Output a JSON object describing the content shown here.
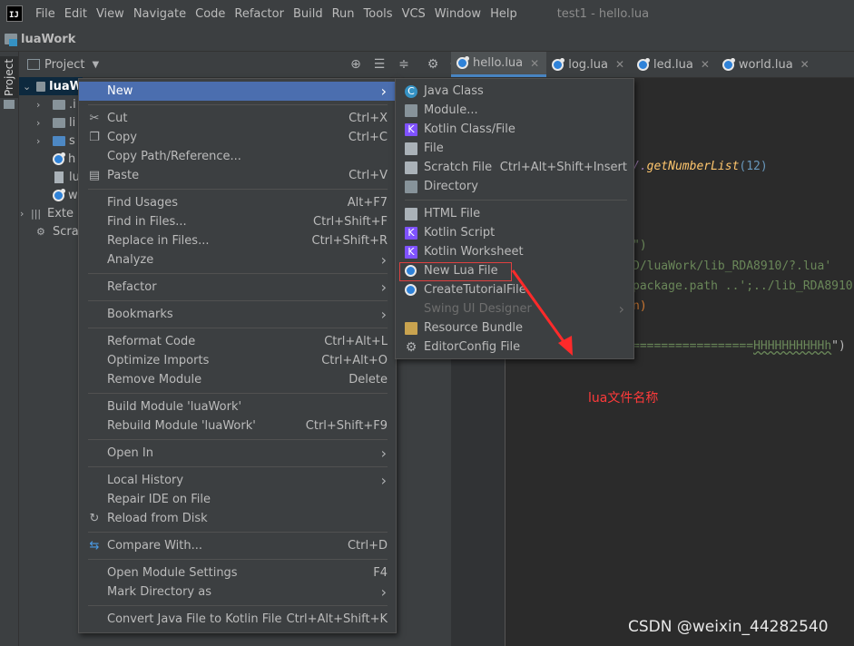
{
  "menubar": {
    "logo": "IJ",
    "items": [
      "File",
      "Edit",
      "View",
      "Navigate",
      "Code",
      "Refactor",
      "Build",
      "Run",
      "Tools",
      "VCS",
      "Window",
      "Help"
    ],
    "window_title": "test1 - hello.lua"
  },
  "navbar": {
    "project_name": "luaWork"
  },
  "toolstrip": {
    "project_tab": "Project"
  },
  "project_panel": {
    "header_label": "Project",
    "tree": [
      {
        "label": "luaW",
        "kind": "project-root"
      },
      {
        "label": ".i",
        "kind": "folder"
      },
      {
        "label": "li",
        "kind": "folder"
      },
      {
        "label": "s",
        "kind": "folder"
      },
      {
        "label": "h",
        "kind": "lua"
      },
      {
        "label": "lu",
        "kind": "file"
      },
      {
        "label": "w",
        "kind": "lua"
      },
      {
        "label": "Exte",
        "kind": "libraries"
      },
      {
        "label": "Scra",
        "kind": "scratches"
      }
    ]
  },
  "tabs": [
    {
      "label": "hello.lua",
      "active": true
    },
    {
      "label": "log.lua",
      "active": false
    },
    {
      "label": "led.lua",
      "active": false
    },
    {
      "label": "world.lua",
      "active": false
    }
  ],
  "code_fragments": {
    "line1_prefix": "/.",
    "line1_call": "getNumberList",
    "line1_args": "(12)",
    "line2": "\")",
    "line3": "D/luaWork/lib_RDA8910/?.lua'",
    "line4": "package.path ..';../lib_RDA8910",
    "line5": "n)",
    "line6_eq": "=================",
    "line6_h": "HHHHHHHHHHh",
    "line6_end": "\")"
  },
  "context_menu": {
    "items": [
      {
        "label": "New",
        "shortcut": "",
        "submenu": true,
        "selected": true,
        "icon": ""
      },
      {
        "sep": true
      },
      {
        "label": "Cut",
        "shortcut": "Ctrl+X",
        "icon": "scissors-icon"
      },
      {
        "label": "Copy",
        "shortcut": "Ctrl+C",
        "icon": "copy-icon"
      },
      {
        "label": "Copy Path/Reference...",
        "shortcut": ""
      },
      {
        "label": "Paste",
        "shortcut": "Ctrl+V",
        "icon": "paste-icon"
      },
      {
        "sep": true
      },
      {
        "label": "Find Usages",
        "shortcut": "Alt+F7"
      },
      {
        "label": "Find in Files...",
        "shortcut": "Ctrl+Shift+F"
      },
      {
        "label": "Replace in Files...",
        "shortcut": "Ctrl+Shift+R"
      },
      {
        "label": "Analyze",
        "submenu": true
      },
      {
        "sep": true
      },
      {
        "label": "Refactor",
        "submenu": true
      },
      {
        "sep": true
      },
      {
        "label": "Bookmarks",
        "submenu": true
      },
      {
        "sep": true
      },
      {
        "label": "Reformat Code",
        "shortcut": "Ctrl+Alt+L"
      },
      {
        "label": "Optimize Imports",
        "shortcut": "Ctrl+Alt+O"
      },
      {
        "label": "Remove Module",
        "shortcut": "Delete"
      },
      {
        "sep": true
      },
      {
        "label": "Build Module 'luaWork'",
        "shortcut": ""
      },
      {
        "label": "Rebuild Module 'luaWork'",
        "shortcut": "Ctrl+Shift+F9"
      },
      {
        "sep": true
      },
      {
        "label": "Open In",
        "submenu": true
      },
      {
        "sep": true
      },
      {
        "label": "Local History",
        "submenu": true
      },
      {
        "label": "Repair IDE on File",
        "shortcut": ""
      },
      {
        "label": "Reload from Disk",
        "shortcut": "",
        "icon": "reload-icon"
      },
      {
        "sep": true
      },
      {
        "label": "Compare With...",
        "shortcut": "Ctrl+D",
        "icon": "compare-icon"
      },
      {
        "sep": true
      },
      {
        "label": "Open Module Settings",
        "shortcut": "F4"
      },
      {
        "label": "Mark Directory as",
        "submenu": true
      },
      {
        "sep": true
      },
      {
        "label": "Convert Java File to Kotlin File",
        "shortcut": "Ctrl+Alt+Shift+K"
      }
    ]
  },
  "new_submenu": {
    "items": [
      {
        "label": "Java Class",
        "icon": "java-class-icon"
      },
      {
        "label": "Module...",
        "icon": "module-icon"
      },
      {
        "label": "Kotlin Class/File",
        "icon": "kotlin-icon"
      },
      {
        "label": "File",
        "icon": "file-icon"
      },
      {
        "label": "Scratch File",
        "shortcut": "Ctrl+Alt+Shift+Insert",
        "icon": "scratch-icon"
      },
      {
        "label": "Directory",
        "icon": "folder-icon"
      },
      {
        "sep": true
      },
      {
        "label": "HTML File",
        "icon": "html-icon"
      },
      {
        "label": "Kotlin Script",
        "icon": "kotlin-script-icon"
      },
      {
        "label": "Kotlin Worksheet",
        "icon": "kotlin-worksheet-icon"
      },
      {
        "label": "New Lua File",
        "icon": "lua-icon",
        "highlighted": true
      },
      {
        "label": "CreateTutorialFile",
        "icon": "lua-icon"
      },
      {
        "label": "Swing UI Designer",
        "submenu": true,
        "disabled": true
      },
      {
        "label": "Resource Bundle",
        "icon": "resource-bundle-icon"
      },
      {
        "label": "EditorConfig File",
        "icon": "gear-icon"
      }
    ]
  },
  "annotation": {
    "text": "lua文件名称"
  },
  "watermark": {
    "text": "CSDN @weixin_44282540"
  },
  "colors": {
    "selection": "#4b6eaf",
    "annotation": "#ff3a3a",
    "accent_tab": "#4a88c7"
  }
}
